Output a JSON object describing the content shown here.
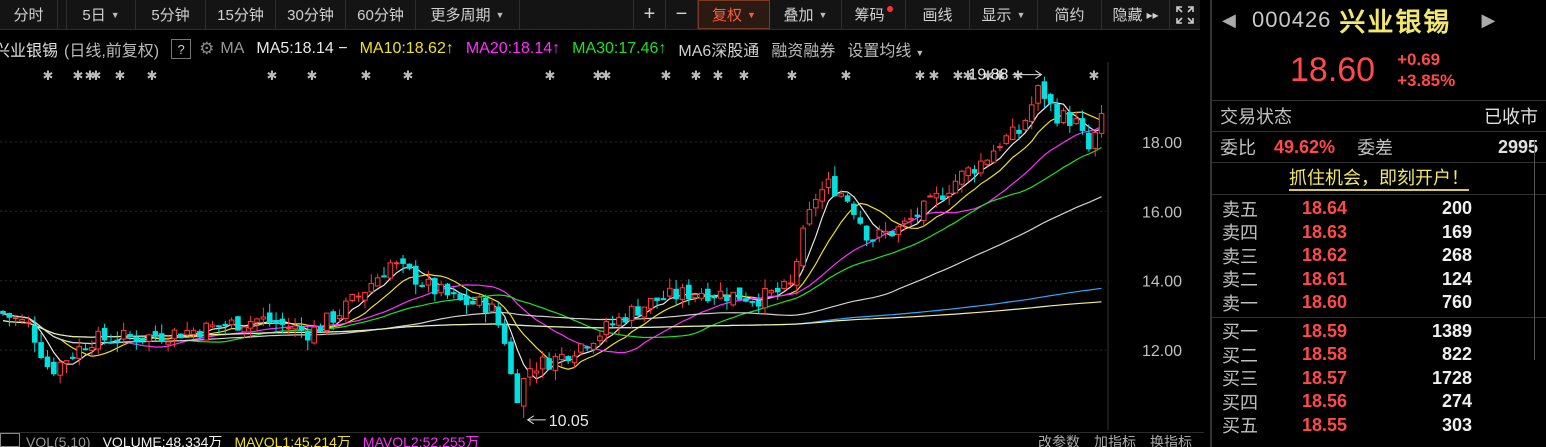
{
  "toolbar": {
    "periods": [
      {
        "label": "分时",
        "caret": false
      },
      {
        "label": "5日",
        "caret": true
      },
      {
        "label": "5分钟",
        "caret": false
      },
      {
        "label": "15分钟",
        "caret": false
      },
      {
        "label": "30分钟",
        "caret": false
      },
      {
        "label": "60分钟",
        "caret": false
      },
      {
        "label": "更多周期",
        "caret": true
      }
    ],
    "zoom_in": "+",
    "zoom_out": "−",
    "fuquan": "复权",
    "diejia": "叠加",
    "chouma": "筹码",
    "huaxian": "画线",
    "xianshi": "显示",
    "jianyue": "简约",
    "yincang": "隐藏"
  },
  "legend": {
    "stock": "兴业银锡",
    "mode": "(日线,前复权)",
    "help": "?",
    "ma": "MA",
    "ma5": "MA5:18.14",
    "ma5_arrow": "−",
    "ma10": "MA10:18.62",
    "ma10_arrow": "↑",
    "ma20": "MA20:18.14",
    "ma20_arrow": "↑",
    "ma30": "MA30:17.46",
    "ma30_arrow": "↑",
    "ma6": "MA6深股通",
    "rzrq": "融资融券",
    "settings": "设置均线"
  },
  "chart_data": {
    "type": "candlestick",
    "y_ticks": [
      "18.00",
      "16.00",
      "14.00",
      "12.00"
    ],
    "ylim": [
      9.7,
      20.3
    ],
    "high_label": "19.88",
    "low_label": "10.05",
    "colors": {
      "up": "#ff3b3b",
      "down": "#00e0e0",
      "ma5": "#e8e8e8",
      "ma10": "#f0e020",
      "ma20": "#ff30ff",
      "ma30": "#20e020",
      "ma60": "#d0d0d0",
      "ma120": "#30a8ff",
      "ma250": "#f0f0a0"
    }
  },
  "volstrip": {
    "vol": "VOL(5,10)",
    "volume": "VOLUME:48.334万",
    "mavol1": "MAVOL1:45.214万",
    "mavol2": "MAVOL2:52.255万",
    "change": "改参数",
    "add": "加指标",
    "swap": "换指标"
  },
  "panel": {
    "code": "000426",
    "name": "兴业银锡",
    "price": "18.60",
    "change": "+0.69",
    "change_pct": "+3.85%",
    "status_label": "交易状态",
    "status_value": "已收市",
    "weibi_label": "委比",
    "weibi_value": "49.62%",
    "weicha_label": "委差",
    "weicha_value": "2995",
    "promo": "抓住机会，即刻开户！",
    "sell": [
      {
        "name": "卖五",
        "price": "18.64",
        "vol": "200"
      },
      {
        "name": "卖四",
        "price": "18.63",
        "vol": "169"
      },
      {
        "name": "卖三",
        "price": "18.62",
        "vol": "268"
      },
      {
        "name": "卖二",
        "price": "18.61",
        "vol": "124"
      },
      {
        "name": "卖一",
        "price": "18.60",
        "vol": "760"
      }
    ],
    "buy": [
      {
        "name": "买一",
        "price": "18.59",
        "vol": "1389"
      },
      {
        "name": "买二",
        "price": "18.58",
        "vol": "822"
      },
      {
        "name": "买三",
        "price": "18.57",
        "vol": "1728"
      },
      {
        "name": "买四",
        "price": "18.56",
        "vol": "274"
      },
      {
        "name": "买五",
        "price": "18.55",
        "vol": "303"
      }
    ]
  }
}
